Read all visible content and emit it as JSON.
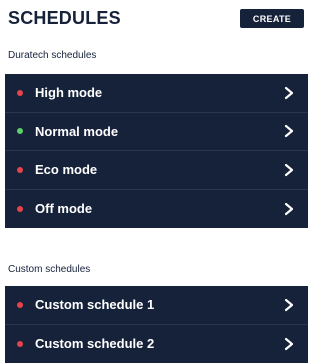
{
  "header": {
    "title": "SCHEDULES",
    "create_label": "CREATE"
  },
  "colors": {
    "navy": "#16213a",
    "status_red": "#e8434c",
    "status_green": "#5fd068"
  },
  "sections": [
    {
      "label": "Duratech schedules",
      "items": [
        {
          "label": "High mode",
          "status": "red",
          "icon": "chevron-right-icon"
        },
        {
          "label": "Normal mode",
          "status": "green",
          "icon": "chevron-right-icon"
        },
        {
          "label": "Eco mode",
          "status": "red",
          "icon": "chevron-right-icon"
        },
        {
          "label": "Off mode",
          "status": "red",
          "icon": "chevron-right-icon"
        }
      ]
    },
    {
      "label": "Custom schedules",
      "items": [
        {
          "label": "Custom schedule 1",
          "status": "red",
          "icon": "chevron-right-icon"
        },
        {
          "label": "Custom schedule 2",
          "status": "red",
          "icon": "chevron-right-icon"
        }
      ]
    }
  ]
}
